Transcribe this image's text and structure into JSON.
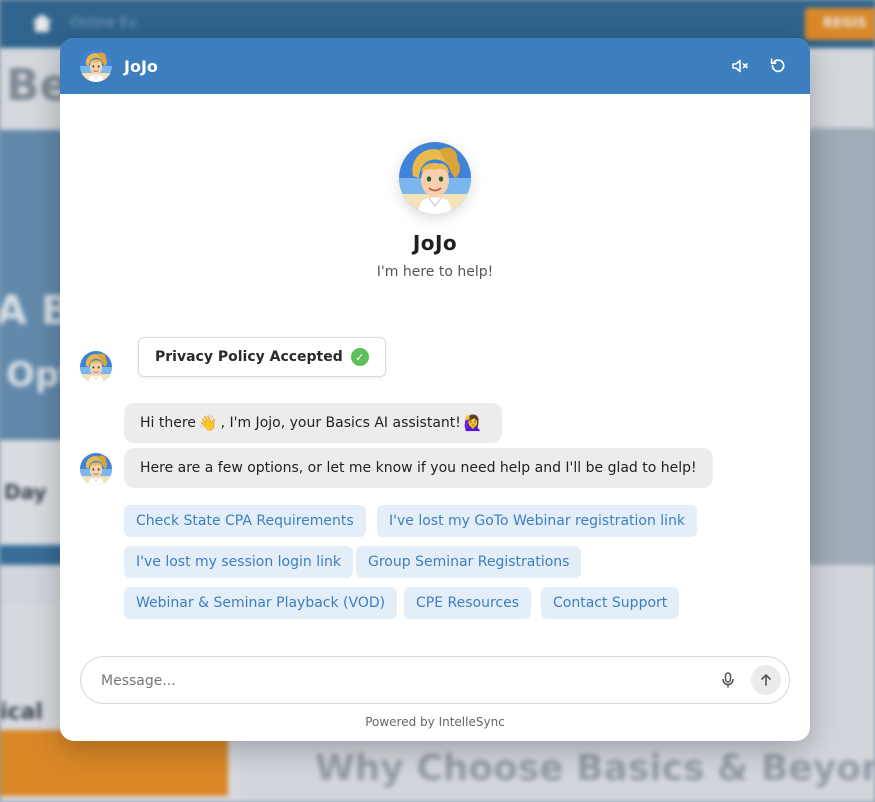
{
  "background_page": {
    "breadcrumb": "Online Ev",
    "cta": "REGIS",
    "heading_fragment": "Be",
    "hero_fragment_1": "A Be",
    "hero_fragment_2": "Opt",
    "card_fragment": "Day",
    "lower_fragment": "ical",
    "section_heading": "Why Choose Basics & Beyond?"
  },
  "widget": {
    "header": {
      "name": "JoJo",
      "mute_icon": "speaker-muted-icon",
      "reset_icon": "refresh-icon"
    },
    "intro": {
      "title": "JoJo",
      "subtitle": "I'm here to help!"
    },
    "privacy_badge": {
      "label": "Privacy Policy Accepted",
      "icon": "check-circle-icon"
    },
    "messages": [
      {
        "before_wave": "Hi there",
        "wave_emoji": "👋",
        "middle": ", I'm Jojo, your Basics AI assistant!",
        "end_emoji": "🙋‍♀️"
      },
      {
        "text": "Here are a few options, or let me know if you need help and I'll be glad to help!"
      }
    ],
    "quick_replies": [
      "Check State CPA Requirements",
      "I've lost my GoTo Webinar registration link",
      "I've lost my session login link",
      "Group Seminar Registrations",
      "Webinar & Seminar Playback (VOD)",
      "CPE Resources",
      "Contact Support"
    ],
    "composer": {
      "placeholder": "Message...",
      "mic_icon": "microphone-icon",
      "send_icon": "arrow-up-icon"
    },
    "footer": "Powered by IntelleSync"
  },
  "colors": {
    "header_blue": "#3d7ebf",
    "chip_bg": "#e4eef8",
    "bubble_bg": "#ececec",
    "check_green": "#5fbf5a"
  }
}
